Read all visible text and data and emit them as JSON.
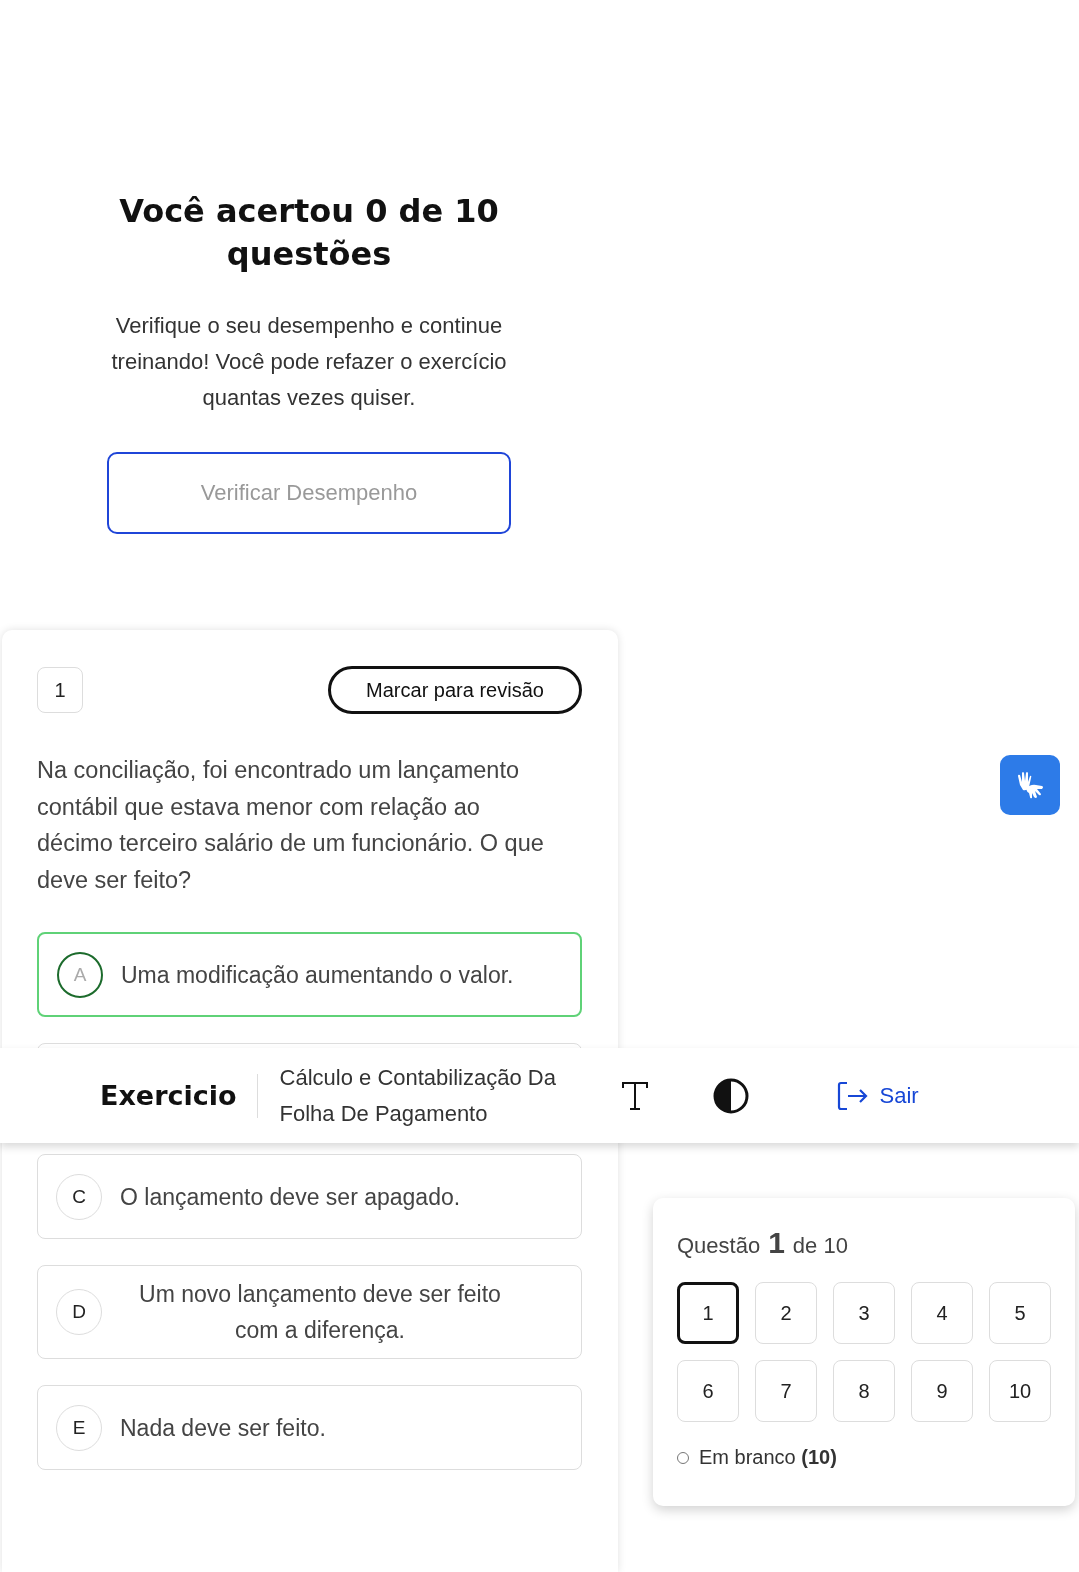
{
  "result": {
    "title": "Você acertou 0 de 10 questões",
    "message": "Verifique o seu desempenho e continue treinando! Você pode refazer o exercício quantas vezes quiser.",
    "button": "Verificar Desempenho"
  },
  "question": {
    "number": "1",
    "review_button": "Marcar para revisão",
    "text": "Na conciliação, foi encontrado um lançamento contábil que estava menor com relação ao décimo terceiro salário de um funcionário. O que deve ser feito?",
    "options": [
      {
        "kind": "option",
        "letter": "A",
        "text": "Uma modificação aumentando o valor.",
        "selected": true
      },
      {
        "kind": "covered"
      },
      {
        "kind": "option",
        "letter": "C",
        "text": "O lançamento deve ser apagado.",
        "selected": false
      },
      {
        "kind": "option",
        "letter": "D",
        "text": "Um novo lançamento deve ser feito com a diferença.",
        "selected": false
      },
      {
        "kind": "option",
        "letter": "E",
        "text": "Nada deve ser feito.",
        "selected": false
      }
    ]
  },
  "header": {
    "title": "Exercicio",
    "subject": "Cálculo e Contabilização Da Folha De Pagamento",
    "exit": "Sair"
  },
  "navigator": {
    "label": "Questão",
    "current": "1",
    "total_text": "de 10",
    "questions": [
      {
        "label": "1",
        "selected": true
      },
      {
        "label": "2",
        "selected": false
      },
      {
        "label": "3",
        "selected": false
      },
      {
        "label": "4",
        "selected": false
      },
      {
        "label": "5",
        "selected": false
      },
      {
        "label": "6",
        "selected": false
      },
      {
        "label": "7",
        "selected": false
      },
      {
        "label": "8",
        "selected": false
      },
      {
        "label": "9",
        "selected": false
      },
      {
        "label": "10",
        "selected": false
      }
    ],
    "legend": "Em branco **(10)**"
  }
}
